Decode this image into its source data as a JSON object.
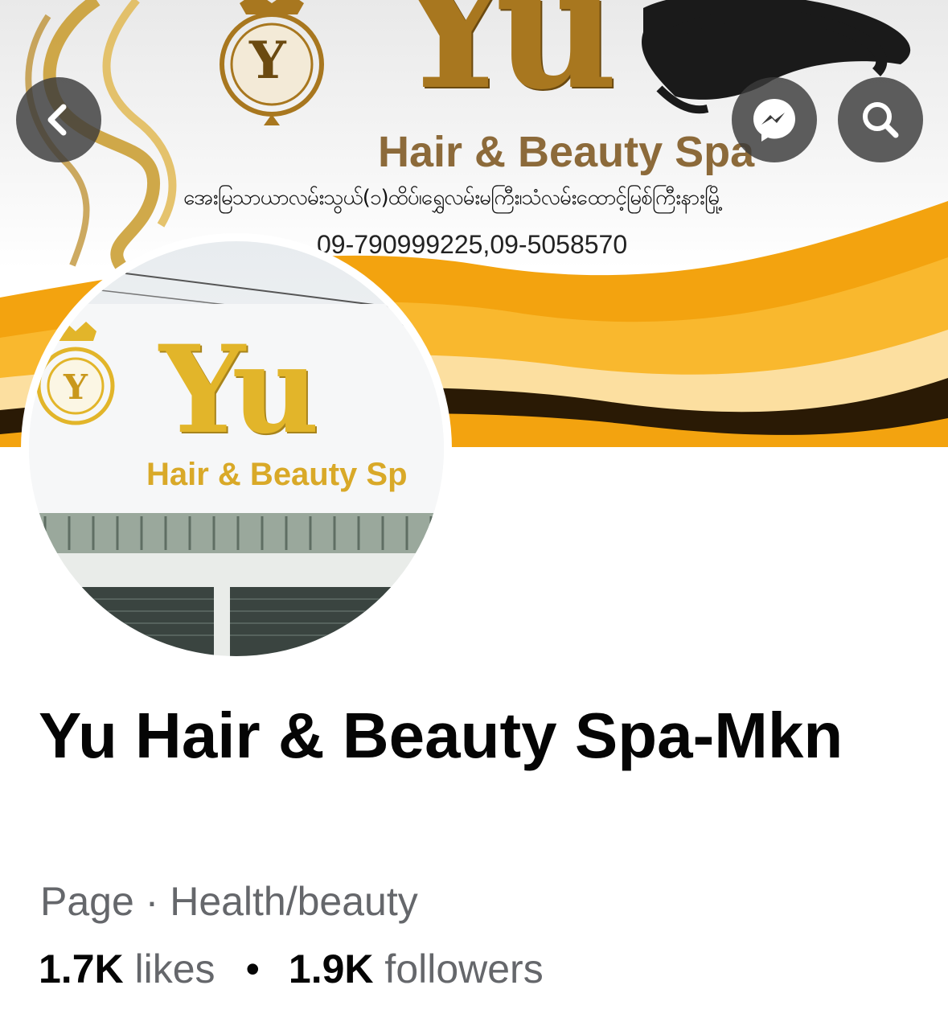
{
  "cover": {
    "brand_word": "Yu",
    "brand_sub": "Hair & Beauty Spa",
    "emblem_letter": "Y",
    "address_burmese": "အေးမြသာယာလမ်းသွယ်(၁)ထိပ်၊ရွှေလမ်းမကြီး၊သံလမ်းထောင့်မြစ်ကြီးနားမြို့",
    "phones": "09-790999225,09-5058570"
  },
  "avatar": {
    "brand_word": "Yu",
    "brand_sub": "Hair & Beauty Sp",
    "emblem_letter": "Y"
  },
  "header_buttons": {
    "back": "chevron-left-icon",
    "messenger": "messenger-icon",
    "search": "search-icon"
  },
  "page": {
    "name": "Yu Hair & Beauty Spa-Mkn",
    "category": "Page · Health/beauty",
    "likes_count": "1.7K",
    "likes_label": "likes",
    "separator": "•",
    "followers_count": "1.9K",
    "followers_label": "followers"
  },
  "colors": {
    "gold": "#a8771f",
    "orange": "#f2a20c",
    "button_bg": "#3a3a3a",
    "text_primary": "#050505",
    "text_secondary": "#65676b"
  }
}
